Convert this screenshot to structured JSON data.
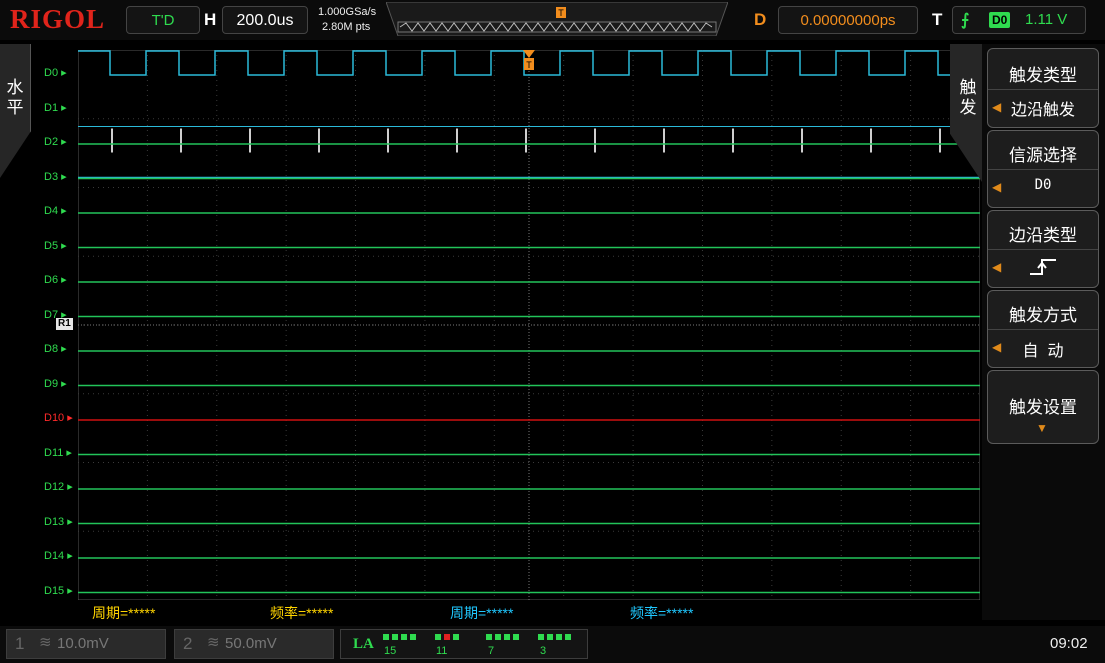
{
  "brand": "RIGOL",
  "header": {
    "run_status": "T'D",
    "timebase_label": "H",
    "timebase_value": "200.0us",
    "sample_rate": "1.000GSa/s",
    "memory_depth": "2.80M pts",
    "delay_label": "D",
    "delay_value": "0.00000000ps",
    "trigger_label": "T",
    "trigger_source": "D0",
    "trigger_level": "1.11 V",
    "trigger_marker": "T"
  },
  "left_tab": {
    "label": "水平"
  },
  "right_tab": {
    "label": "触发"
  },
  "channels": [
    "D0",
    "D1",
    "D2",
    "D3",
    "D4",
    "D5",
    "D6",
    "D7",
    "D8",
    "D9",
    "D10",
    "D11",
    "D12",
    "D13",
    "D14",
    "D15"
  ],
  "ref_marker": "R1",
  "menu": {
    "items": [
      {
        "title": "触发类型",
        "value": "边沿触发"
      },
      {
        "title": "信源选择",
        "value": "D0"
      },
      {
        "title": "边沿类型",
        "value": "rising-edge-icon"
      },
      {
        "title": "触发方式",
        "value": "自  动"
      },
      {
        "title": "触发设置",
        "value": ""
      }
    ]
  },
  "measurements": [
    {
      "text": "周期=*****",
      "color": "#ffd400"
    },
    {
      "text": "频率=*****",
      "color": "#ffd400"
    },
    {
      "text": "周期=*****",
      "color": "#20c8ff"
    },
    {
      "text": "频率=*****",
      "color": "#20c8ff"
    }
  ],
  "footer": {
    "ch1_num": "1",
    "ch1_value": "10.0mV",
    "ch2_num": "2",
    "ch2_value": "50.0mV",
    "la_label": "LA",
    "la_numbers": [
      "15",
      "11",
      "7",
      "3"
    ],
    "time": "09:02"
  },
  "colors": {
    "digital_trace": "#22c45a",
    "active_trace": "#2bbad9",
    "d10_trace": "#d01010",
    "trigger": "#f28d1d"
  }
}
